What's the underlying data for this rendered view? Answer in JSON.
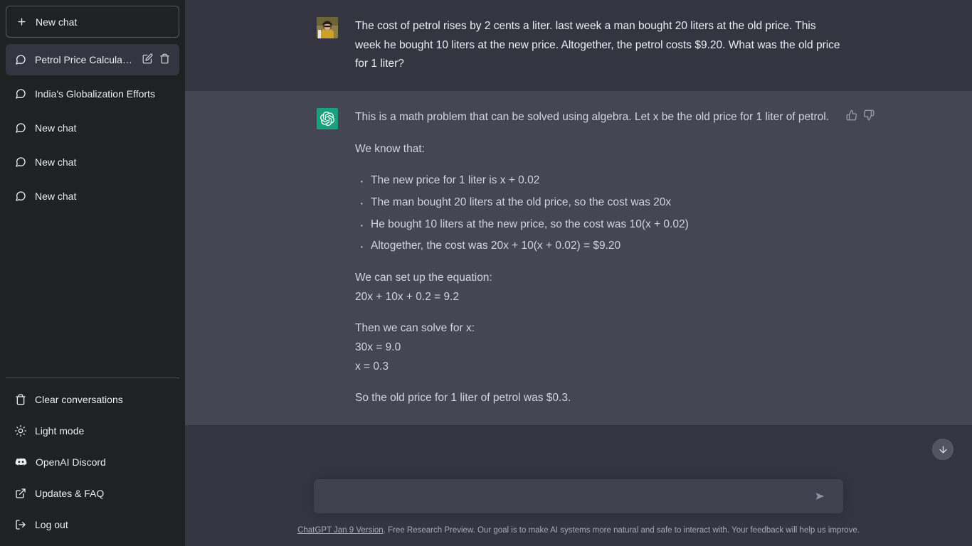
{
  "sidebar": {
    "new_chat_label": "New chat",
    "conversations": [
      {
        "title": "Petrol Price Calculation",
        "active": true
      },
      {
        "title": "India's Globalization Efforts",
        "active": false
      },
      {
        "title": "New chat",
        "active": false
      },
      {
        "title": "New chat",
        "active": false
      },
      {
        "title": "New chat",
        "active": false
      }
    ],
    "menu": [
      {
        "label": "Clear conversations",
        "icon": "trash-icon"
      },
      {
        "label": "Light mode",
        "icon": "sun-icon"
      },
      {
        "label": "OpenAI Discord",
        "icon": "discord-icon"
      },
      {
        "label": "Updates & FAQ",
        "icon": "external-link-icon"
      },
      {
        "label": "Log out",
        "icon": "logout-icon"
      }
    ]
  },
  "conversation": {
    "user_message": "The cost of petrol rises by 2 cents a liter. last week a man bought 20 liters at the old price. This week he bought 10 liters at the new price. Altogether, the petrol costs $9.20. What was the old price for 1 liter?",
    "assistant": {
      "intro": "This is a math problem that can be solved using algebra. Let x be the old price for 1 liter of petrol.",
      "known_heading": "We know that:",
      "bullets": [
        "The new price for 1 liter is x + 0.02",
        "The man bought 20 liters at the old price, so the cost was 20x",
        "He bought 10 liters at the new price, so the cost was 10(x + 0.02)",
        "Altogether, the cost was 20x + 10(x + 0.02) = $9.20"
      ],
      "equation_heading": "We can set up the equation:",
      "equation": "20x + 10x + 0.2 = 9.2",
      "solve_heading": "Then we can solve for x:",
      "solve_step_1": "30x = 9.0",
      "solve_step_2": "x = 0.3",
      "conclusion": "So the old price for 1 liter of petrol was $0.3."
    }
  },
  "composer": {
    "input_value": "",
    "placeholder": ""
  },
  "footer": {
    "link_text": "ChatGPT Jan 9 Version",
    "disclaimer": ". Free Research Preview. Our goal is to make AI systems more natural and safe to interact with. Your feedback will help us improve."
  },
  "colors": {
    "sidebar_bg": "#202123",
    "user_bg": "#343541",
    "assistant_bg": "#444654",
    "brand_green": "#19a07c",
    "input_bg": "#40414f"
  }
}
